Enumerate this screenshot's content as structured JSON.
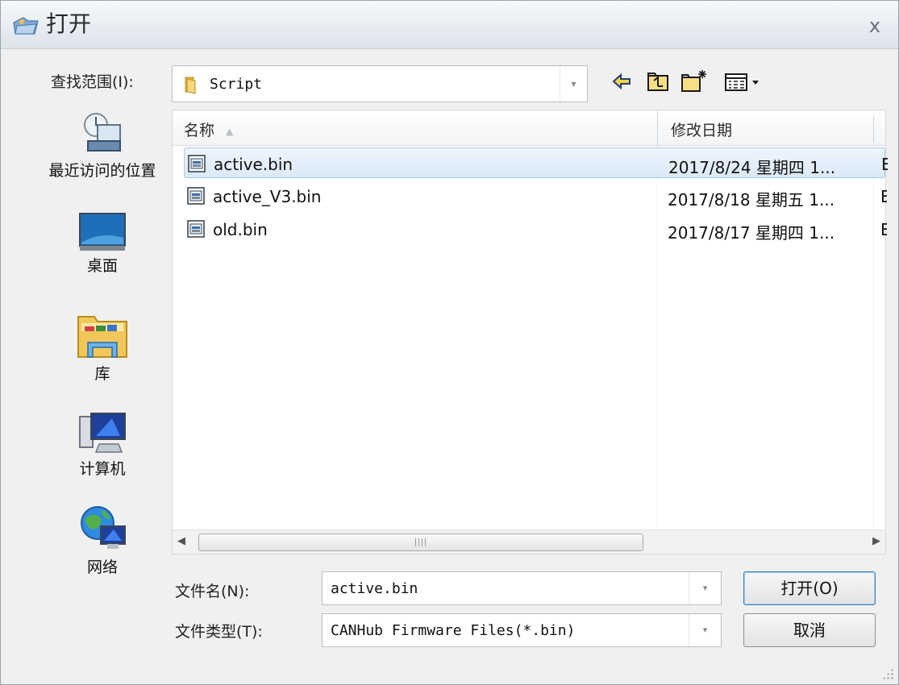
{
  "window": {
    "title": "打开",
    "close_glyph": "x",
    "title_icon": "folder-open-icon"
  },
  "look_in": {
    "label": "查找范围(I):",
    "value": "Script",
    "dropdown_glyph": "▾"
  },
  "toolbar": {
    "back_icon": "back-arrow-icon",
    "up_icon": "up-folder-icon",
    "new_folder_icon": "new-folder-icon",
    "view_menu_icon": "view-menu-icon"
  },
  "places": [
    {
      "label": "最近访问的位置",
      "icon": "recent-places-icon"
    },
    {
      "label": "桌面",
      "icon": "desktop-icon"
    },
    {
      "label": "库",
      "icon": "libraries-icon"
    },
    {
      "label": "计算机",
      "icon": "computer-icon"
    },
    {
      "label": "网络",
      "icon": "network-icon"
    }
  ],
  "file_list": {
    "columns": [
      {
        "label": "名称",
        "sort_indicator": "▲"
      },
      {
        "label": "修改日期"
      }
    ],
    "rows": [
      {
        "name": "active.bin",
        "date": "2017/8/24 星期四 1...",
        "extra": "E",
        "selected": true
      },
      {
        "name": "active_V3.bin",
        "date": "2017/8/18 星期五 1...",
        "extra": "E",
        "selected": false
      },
      {
        "name": "old.bin",
        "date": "2017/8/17 星期四 1...",
        "extra": "E",
        "selected": false
      }
    ],
    "scroll": {
      "left_glyph": "◀",
      "right_glyph": "▶"
    }
  },
  "file_name": {
    "label": "文件名(N):",
    "value": "active.bin",
    "dropdown_glyph": "▾"
  },
  "file_type": {
    "label": "文件类型(T):",
    "value": "CANHub Firmware Files(*.bin)",
    "dropdown_glyph": "▾"
  },
  "buttons": {
    "open": "打开(O)",
    "cancel": "取消"
  }
}
